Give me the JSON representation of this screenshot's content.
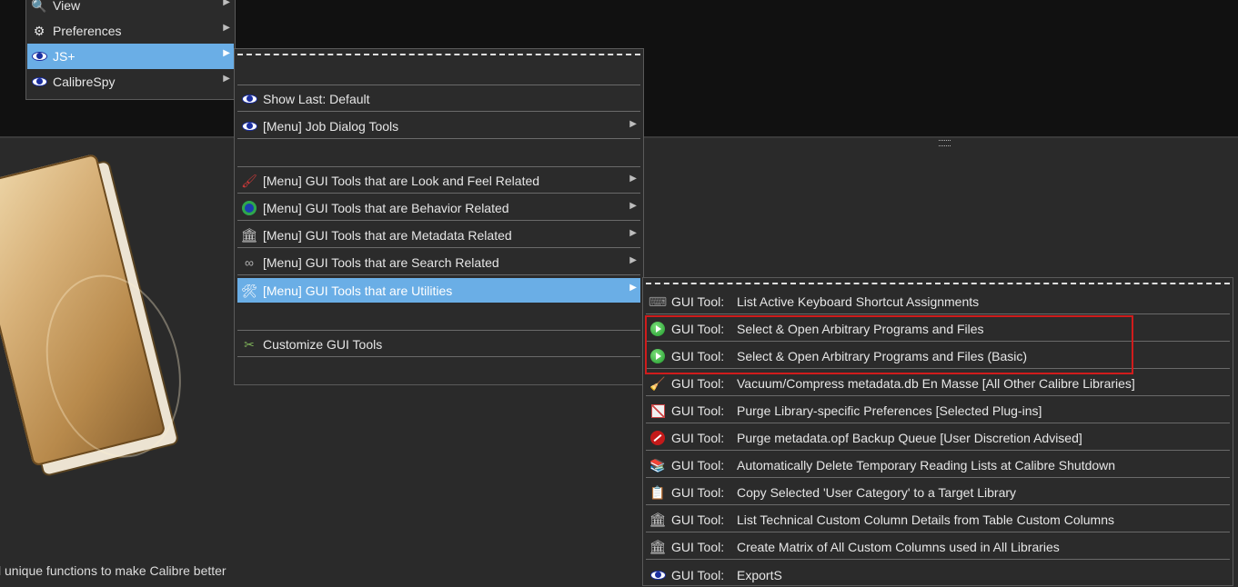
{
  "menu_main": {
    "items": [
      {
        "label": "View",
        "icon": "magnifier-icon"
      },
      {
        "label": "Preferences",
        "icon": "gears-icon"
      },
      {
        "label": "JS+",
        "icon": "eye-icon"
      },
      {
        "label": "CalibreSpy",
        "icon": "spy-eye-icon"
      }
    ]
  },
  "menu_jsplus": {
    "items": [
      {
        "label": "Show Last: Default",
        "icon": "eye-icon"
      },
      {
        "label": "[Menu] Job Dialog Tools",
        "icon": "eye-icon"
      },
      {
        "label": "[Menu] GUI Tools that are Look and Feel Related",
        "icon": "brush-icon"
      },
      {
        "label": "[Menu] GUI Tools that are Behavior Related",
        "icon": "behavior-icon"
      },
      {
        "label": "[Menu] GUI Tools that are Metadata Related",
        "icon": "pillar-icon"
      },
      {
        "label": "[Menu] GUI Tools that are Search Related",
        "icon": "binoculars-icon"
      },
      {
        "label": "[Menu] GUI Tools that are Utilities",
        "icon": "tools-icon"
      },
      {
        "label": "Customize GUI Tools",
        "icon": "wrench-screwdriver-icon"
      }
    ]
  },
  "menu_utilities": {
    "prefix": "GUI Tool:",
    "items": [
      {
        "label": "List Active Keyboard Shortcut Assignments",
        "icon": "keyboard-icon"
      },
      {
        "label": "Select & Open Arbitrary Programs and Files",
        "icon": "green-play-icon"
      },
      {
        "label": "Select & Open Arbitrary Programs and Files (Basic)",
        "icon": "green-play-icon"
      },
      {
        "label": "Vacuum/Compress metadata.db En Masse [All Other Calibre Libraries]",
        "icon": "vacuum-icon"
      },
      {
        "label": "Purge Library-specific Preferences [Selected Plug-ins]",
        "icon": "purge-icon"
      },
      {
        "label": "Purge metadata.opf Backup Queue [User Discretion Advised]",
        "icon": "no-entry-icon"
      },
      {
        "label": "Automatically Delete Temporary Reading Lists at Calibre Shutdown",
        "icon": "books-icon"
      },
      {
        "label": "Copy Selected 'User Category' to a Target Library",
        "icon": "copy-category-icon"
      },
      {
        "label": "List Technical Custom Column Details from Table Custom Columns",
        "icon": "pillar-icon"
      },
      {
        "label": "Create Matrix of All Custom Columns used in All Libraries",
        "icon": "pillar-icon"
      },
      {
        "label": "ExportS",
        "icon": "eye-icon"
      }
    ]
  },
  "footer_text": "l unique functions to make Calibre better",
  "colors": {
    "highlight": "#6aaee6",
    "menu_bg": "#2b2b2b",
    "callout": "#d01c1c"
  }
}
